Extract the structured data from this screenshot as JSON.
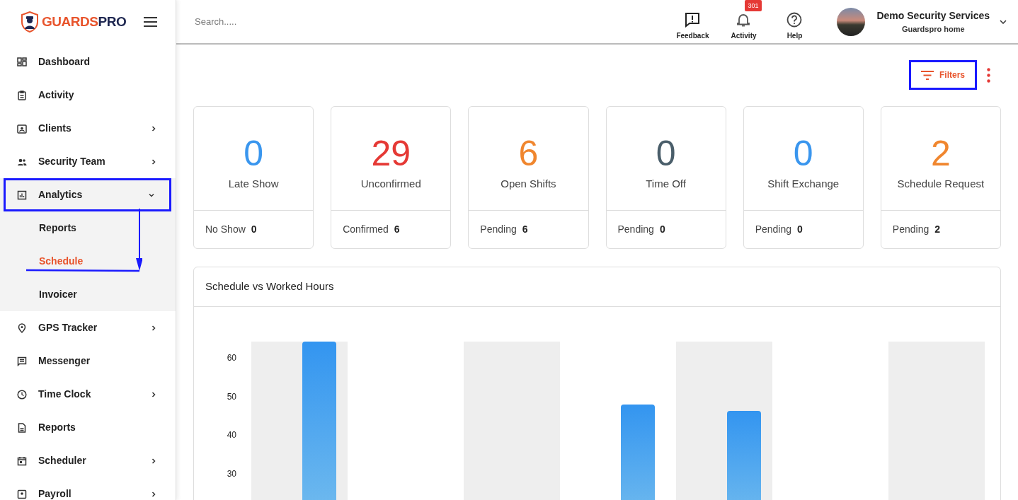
{
  "logo": {
    "brand_first": "GUARDS",
    "brand_second": "PRO"
  },
  "sidebar": {
    "items": [
      {
        "label": "Dashboard",
        "has_submenu": false,
        "expanded": false,
        "highlighted": false
      },
      {
        "label": "Activity",
        "has_submenu": false,
        "expanded": false,
        "highlighted": false
      },
      {
        "label": "Clients",
        "has_submenu": true,
        "expanded": false,
        "highlighted": false
      },
      {
        "label": "Security Team",
        "has_submenu": true,
        "expanded": false,
        "highlighted": false
      },
      {
        "label": "Analytics",
        "has_submenu": true,
        "expanded": true,
        "highlighted": true,
        "children": [
          {
            "label": "Reports",
            "selected": false,
            "marked": false
          },
          {
            "label": "Schedule",
            "selected": true,
            "marked": true
          },
          {
            "label": "Invoicer",
            "selected": false,
            "marked": false
          }
        ]
      },
      {
        "label": "GPS Tracker",
        "has_submenu": true,
        "expanded": false,
        "highlighted": false
      },
      {
        "label": "Messenger",
        "has_submenu": false,
        "expanded": false,
        "highlighted": false
      },
      {
        "label": "Time Clock",
        "has_submenu": true,
        "expanded": false,
        "highlighted": false
      },
      {
        "label": "Reports",
        "has_submenu": false,
        "expanded": false,
        "highlighted": false
      },
      {
        "label": "Scheduler",
        "has_submenu": true,
        "expanded": false,
        "highlighted": false
      },
      {
        "label": "Payroll",
        "has_submenu": true,
        "expanded": false,
        "highlighted": false
      }
    ]
  },
  "header": {
    "search": {
      "placeholder": "Search....."
    },
    "actions": [
      {
        "label": "Feedback"
      },
      {
        "label": "Activity",
        "badge": "301"
      },
      {
        "label": "Help"
      }
    ],
    "account": {
      "name": "Demo Security Services",
      "subtitle": "Guardspro home"
    }
  },
  "toolbar": {
    "filters": {
      "label": "Filters",
      "highlighted": true
    }
  },
  "stat_cards": [
    {
      "value": "0",
      "label": "Late Show",
      "color": "#3a96ee",
      "footer_label": "No Show",
      "footer_value": "0"
    },
    {
      "value": "29",
      "label": "Unconfirmed",
      "color": "#e53935",
      "footer_label": "Confirmed",
      "footer_value": "6"
    },
    {
      "value": "6",
      "label": "Open Shifts",
      "color": "#f0862e",
      "footer_label": "Pending",
      "footer_value": "6"
    },
    {
      "value": "0",
      "label": "Time Off",
      "color": "#4a5e6a",
      "footer_label": "Pending",
      "footer_value": "0"
    },
    {
      "value": "0",
      "label": "Shift Exchange",
      "color": "#3a96ee",
      "footer_label": "Pending",
      "footer_value": "0"
    },
    {
      "value": "2",
      "label": "Schedule Request",
      "color": "#f0862e",
      "footer_label": "Pending",
      "footer_value": "2"
    }
  ],
  "chart_panel": {
    "title": "Schedule vs Worked Hours",
    "y_axis_labels": [
      "60",
      "50",
      "40",
      "30"
    ]
  }
}
